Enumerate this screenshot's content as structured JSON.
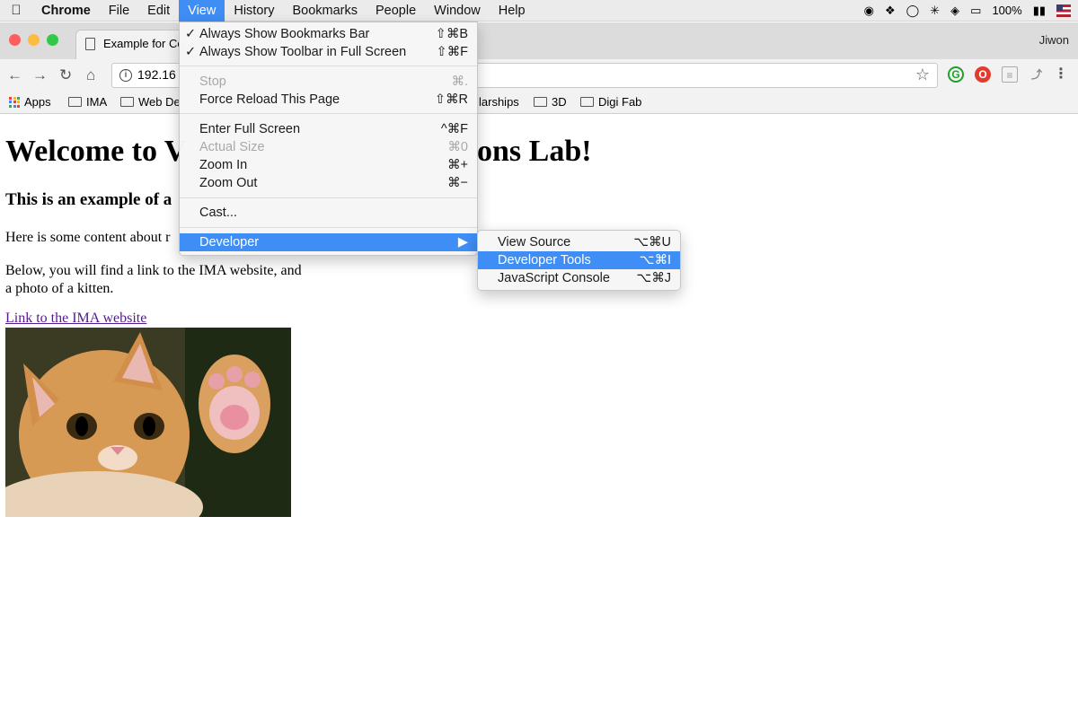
{
  "menubar": {
    "app": "Chrome",
    "menus": [
      "File",
      "Edit",
      "View",
      "History",
      "Bookmarks",
      "People",
      "Window",
      "Help"
    ],
    "battery": "100%"
  },
  "tab": {
    "title": "Example for Co"
  },
  "profile": "Jiwon",
  "omnibox": {
    "url": "192.16"
  },
  "bookmarks": [
    "Apps",
    "IMA",
    "Web De",
    "larships",
    "3D",
    "Digi Fab"
  ],
  "page": {
    "h1_left": "Welcome to V",
    "h1_right": "ons Lab!",
    "h2": "This is an example of a",
    "p1": "Here is some content about r",
    "p2": "Below, you will find a link to the IMA website, and a photo of a kitten.",
    "link": "Link to the IMA website"
  },
  "view_menu": {
    "items": [
      {
        "label": "Always Show Bookmarks Bar",
        "shortcut": "⇧⌘B",
        "checked": "✓"
      },
      {
        "label": "Always Show Toolbar in Full Screen",
        "shortcut": "⇧⌘F",
        "checked": "✓"
      },
      {
        "label": "Stop",
        "shortcut": "⌘."
      },
      {
        "label": "Force Reload This Page",
        "shortcut": "⇧⌘R"
      },
      {
        "label": "Enter Full Screen",
        "shortcut": "^⌘F"
      },
      {
        "label": "Actual Size",
        "shortcut": "⌘0"
      },
      {
        "label": "Zoom In",
        "shortcut": "⌘+"
      },
      {
        "label": "Zoom Out",
        "shortcut": "⌘−"
      },
      {
        "label": "Cast..."
      },
      {
        "label": "Developer",
        "shortcut": "▶"
      }
    ]
  },
  "dev_menu": {
    "items": [
      {
        "label": "View Source",
        "shortcut": "⌥⌘U"
      },
      {
        "label": "Developer Tools",
        "shortcut": "⌥⌘I"
      },
      {
        "label": "JavaScript Console",
        "shortcut": "⌥⌘J"
      }
    ]
  },
  "colors": {
    "accent": "#3f8ef5",
    "visited_link": "#551a8b"
  }
}
